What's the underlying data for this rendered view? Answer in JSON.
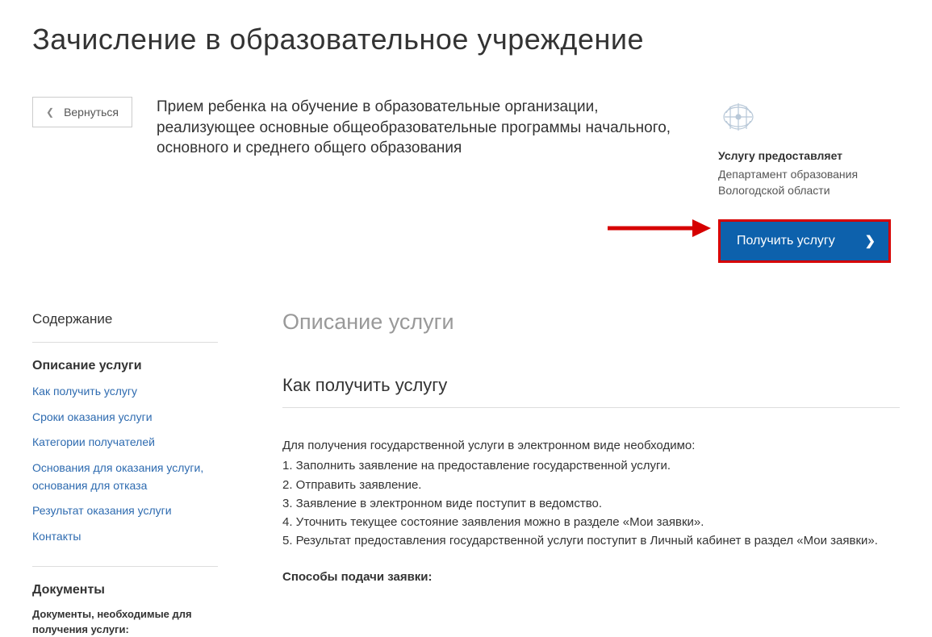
{
  "pageTitle": "Зачисление в образовательное учреждение",
  "backButton": {
    "label": "Вернуться"
  },
  "description": "Прием ребенка на обучение в образовательные организации, реализующее основные общеобразовательные программы начального, основного и среднего общего образования",
  "provider": {
    "label": "Услугу предоставляет",
    "name": "Департамент образования Вологодской области"
  },
  "getServiceButton": {
    "label": "Получить услугу"
  },
  "sidebar": {
    "title": "Содержание",
    "sectionTitle": "Описание услуги",
    "links": {
      "0": "Как получить услугу",
      "1": "Сроки оказания услуги",
      "2": "Категории получателей",
      "3": "Основания для оказания услуги, основания для отказа",
      "4": "Результат оказания услуги",
      "5": "Контакты"
    },
    "docsTitle": "Документы",
    "docsItem": "Документы, необходимые для получения услуги:"
  },
  "content": {
    "heading": "Описание услуги",
    "subheading": "Как получить услугу",
    "intro": "Для получения государственной услуги в электронном виде необходимо:",
    "steps": {
      "0": "1. Заполнить заявление на предоставление государственной услуги.",
      "1": "2. Отправить заявление.",
      "2": "3. Заявление в электронном виде поступит в ведомство.",
      "3": "4. Уточнить текущее состояние заявления можно в разделе «Мои заявки».",
      "4": "5. Результат предоставления государственной услуги поступит в Личный кабинет в раздел «Мои заявки»."
    },
    "submitMethodsTitle": "Способы подачи заявки:"
  }
}
